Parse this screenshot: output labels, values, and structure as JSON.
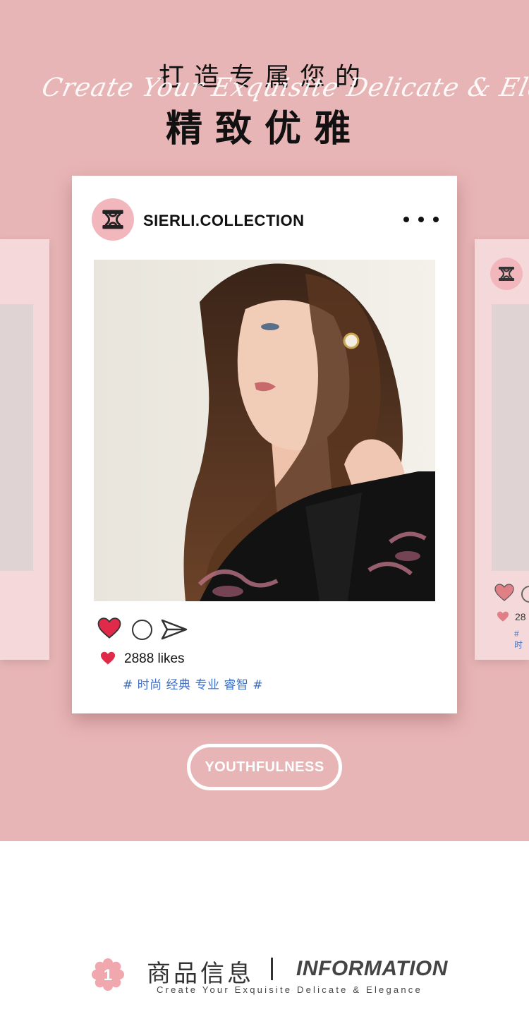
{
  "hero": {
    "title_line1": "打造专属您的",
    "script_text": "Create Your Exquisite Delicate & Elegance",
    "title_line2": "精致优雅"
  },
  "post": {
    "username": "SIERLI.COLLECTION",
    "likes": "2888 likes",
    "tags": "# 时尚 经典 专业 睿智 #",
    "like_color": "#e02a4a"
  },
  "side_post": {
    "likes_partial": "28",
    "tags_partial": "# 时"
  },
  "badge": {
    "label": "YOUTHFULNESS"
  },
  "info": {
    "number": "1",
    "title_cn": "商品信息",
    "title_en": "INFORMATION",
    "subtitle": "Create Your Exquisite Delicate & Elegance"
  },
  "colors": {
    "hero_bg": "#e8b5b6",
    "card_bg": "#ffffff",
    "tag_blue": "#3f6fc4",
    "badge_pink": "#f0a7ad"
  }
}
